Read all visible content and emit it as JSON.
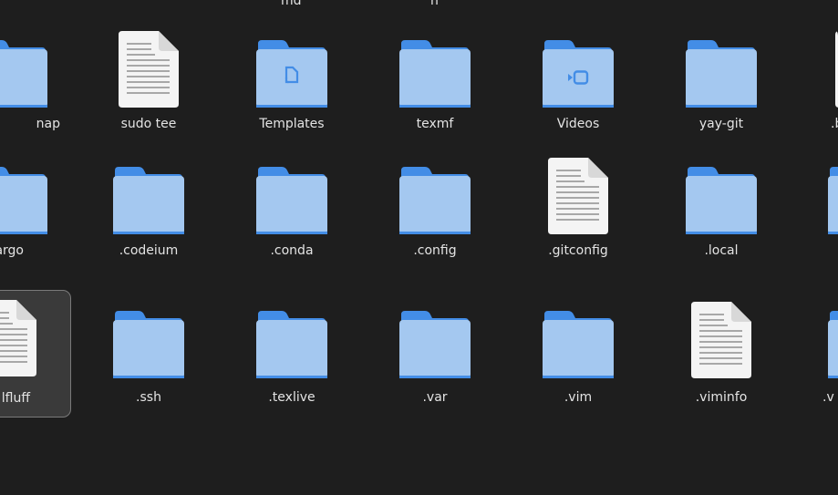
{
  "file_grid": {
    "top_row_labels": [
      "md",
      "n"
    ],
    "row1": [
      "nap",
      "sudo tee",
      "Templates",
      "texmf",
      "Videos",
      "yay-git",
      ".ba"
    ],
    "row2": [
      "argo",
      ".codeium",
      ".conda",
      ".config",
      ".gitconfig",
      ".local"
    ],
    "row3": [
      "lfluff",
      ".ssh",
      ".texlive",
      ".var",
      ".vim",
      ".viminfo",
      ".v"
    ]
  },
  "colors": {
    "background": "#1e1e1e",
    "folder_front": "#a4c8f0",
    "folder_back": "#438de6",
    "document": "#f4f4f4",
    "selected_bg": "#3a3a3a"
  },
  "icons": {
    "folder": "folder-icon",
    "document": "text-file-icon",
    "templates_emblem": "document-emblem-icon",
    "videos_emblem": "video-camera-emblem-icon"
  }
}
